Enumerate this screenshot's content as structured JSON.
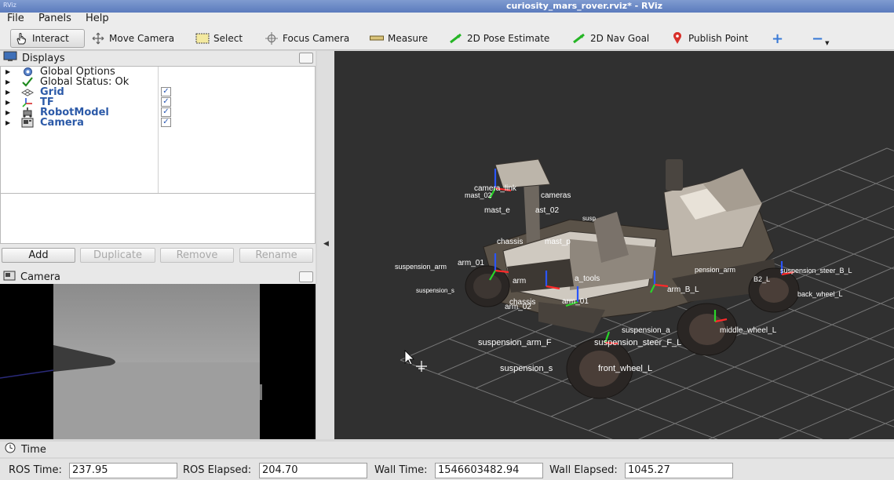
{
  "window": {
    "app_icon": "RViz",
    "title": "curiosity_mars_rover.rviz* - RViz"
  },
  "menu": [
    {
      "label": "File"
    },
    {
      "label": "Panels"
    },
    {
      "label": "Help"
    }
  ],
  "toolbar": {
    "interact": "Interact",
    "move_camera": "Move Camera",
    "select": "Select",
    "focus_camera": "Focus Camera",
    "measure": "Measure",
    "pose_estimate": "2D Pose Estimate",
    "nav_goal": "2D Nav Goal",
    "publish_point": "Publish Point",
    "add_tool": "+",
    "remove_tool": "−"
  },
  "displays": {
    "title": "Displays",
    "items": [
      {
        "label": "Global Options",
        "icon": "gear-icon",
        "checked": null
      },
      {
        "label": "Global Status: Ok",
        "icon": "check-icon",
        "checked": null
      },
      {
        "label": "Grid",
        "icon": "grid-icon",
        "checked": true
      },
      {
        "label": "TF",
        "icon": "axes-icon",
        "checked": true
      },
      {
        "label": "RobotModel",
        "icon": "robot-icon",
        "checked": true
      },
      {
        "label": "Camera",
        "icon": "camera-icon",
        "checked": true
      }
    ],
    "check_mark": "✓",
    "buttons": {
      "add": "Add",
      "duplicate": "Duplicate",
      "remove": "Remove",
      "rename": "Rename"
    }
  },
  "camera_panel": {
    "title": "Camera"
  },
  "scene_labels": {
    "l01": "camera_link",
    "l02": "mast_02",
    "l03": "cameras",
    "l04": "mast_e",
    "l05": "ast_02",
    "l06": "susp",
    "l07": "chassis",
    "l08": "mast_p",
    "l09": "suspension_arm",
    "l10": "arm_01",
    "l11": "arm",
    "l12": "a_tools",
    "l13": "suspension_s",
    "l14": "chassis",
    "l15": "arm_01",
    "l16": "arm_02",
    "l17": "arm_B_L",
    "l18": "pension_arm",
    "l19": "B2_L",
    "l20": "suspension_steer_B_L",
    "l21": "back_wheel_L",
    "l22": "suspension_a",
    "l23": "middle_wheel_L",
    "l24": "suspension_arm_F",
    "l25": "suspension_steer_F_L",
    "l26": "suspension_s",
    "l27": "front_wheel_L"
  },
  "time": {
    "title": "Time",
    "ros_time_label": "ROS Time:",
    "ros_time": "237.95",
    "ros_elapsed_label": "ROS Elapsed:",
    "ros_elapsed": "204.70",
    "wall_time_label": "Wall Time:",
    "wall_time": "1546603482.94",
    "wall_elapsed_label": "Wall Elapsed:",
    "wall_elapsed": "1045.27"
  },
  "colors": {
    "titlebar": "#6a88c6",
    "grid_bg": "#303030",
    "grid_line": "#8a8a8a",
    "label_blue": "#2c5aa8"
  }
}
